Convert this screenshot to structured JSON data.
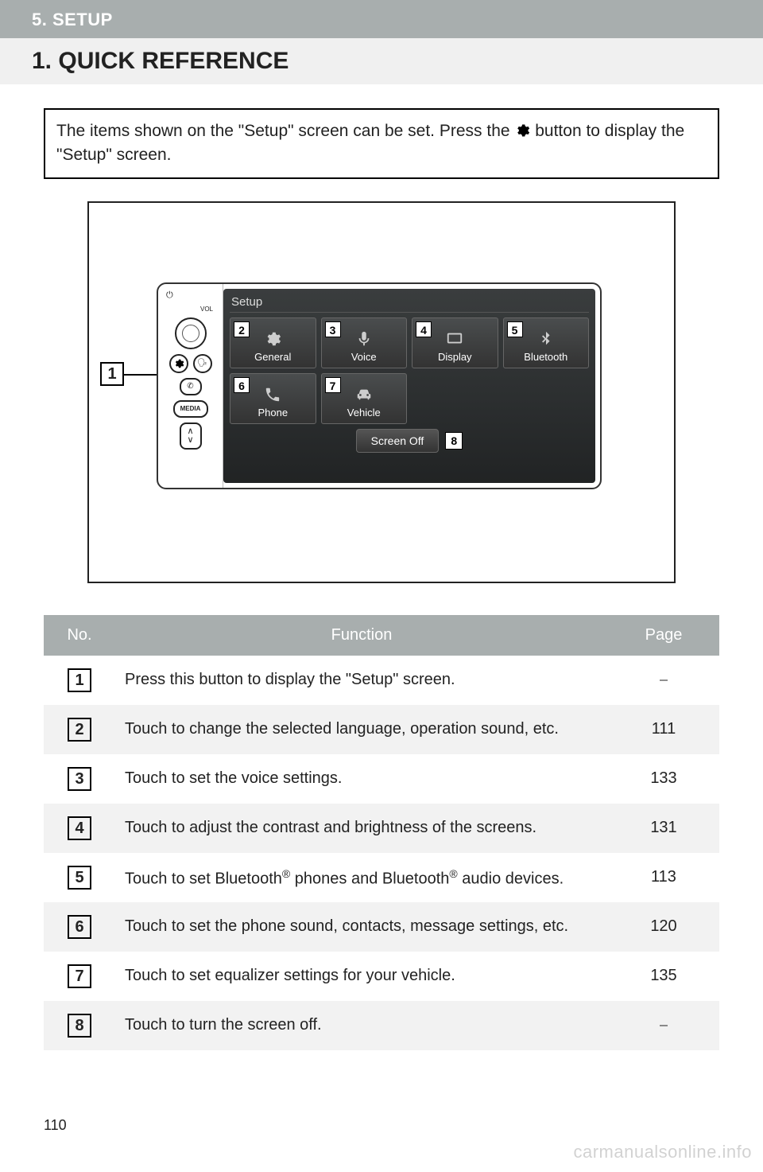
{
  "header": {
    "section": "5. SETUP",
    "title": "1. QUICK REFERENCE"
  },
  "intro": {
    "part1": "The items shown on the \"Setup\" screen can be set. Press the ",
    "part2": " button to display the \"Setup\" screen."
  },
  "device": {
    "callout": "1",
    "vol_label": "VOL",
    "media_label": "MEDIA",
    "screen_title": "Setup",
    "tiles": [
      {
        "num": "2",
        "label": "General",
        "icon": "gear"
      },
      {
        "num": "3",
        "label": "Voice",
        "icon": "mic"
      },
      {
        "num": "4",
        "label": "Display",
        "icon": "monitor"
      },
      {
        "num": "5",
        "label": "Bluetooth",
        "icon": "bt"
      },
      {
        "num": "6",
        "label": "Phone",
        "icon": "phone"
      },
      {
        "num": "7",
        "label": "Vehicle",
        "icon": "car"
      }
    ],
    "screen_off": {
      "num": "8",
      "label": "Screen Off"
    }
  },
  "table": {
    "headers": {
      "no": "No.",
      "func": "Function",
      "page": "Page"
    },
    "rows": [
      {
        "no": "1",
        "func": "Press this button to display the \"Setup\" screen.",
        "page": "⎯"
      },
      {
        "no": "2",
        "func": "Touch to change the selected language, operation sound, etc.",
        "page": "111"
      },
      {
        "no": "3",
        "func": "Touch to set the voice settings.",
        "page": "133"
      },
      {
        "no": "4",
        "func": "Touch to adjust the contrast and brightness of the screens.",
        "page": "131"
      },
      {
        "no": "5",
        "func_html": "Touch to set Bluetooth<sup>®</sup> phones and Bluetooth<sup>®</sup> audio devices.",
        "page": "113"
      },
      {
        "no": "6",
        "func": "Touch to set the phone sound, contacts, message settings, etc.",
        "page": "120"
      },
      {
        "no": "7",
        "func": "Touch to set equalizer settings for your vehicle.",
        "page": "135"
      },
      {
        "no": "8",
        "func": "Touch to turn the screen off.",
        "page": "⎯"
      }
    ]
  },
  "page_number": "110",
  "watermark": "carmanualsonline.info"
}
